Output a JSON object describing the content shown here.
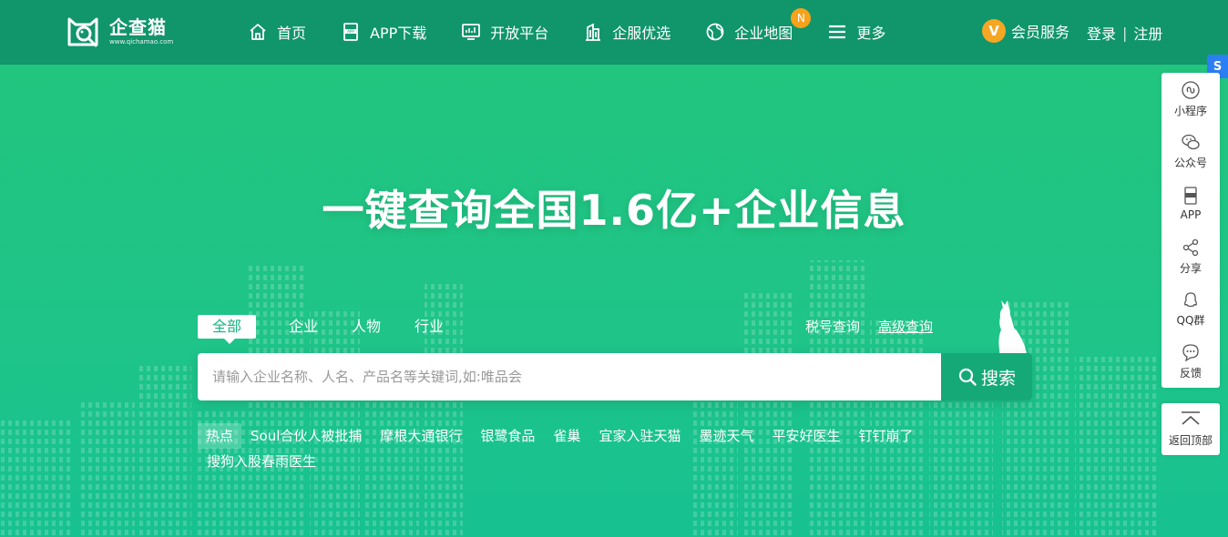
{
  "brand": {
    "name": "企查猫",
    "url": "www.qichamao.com"
  },
  "nav": {
    "items": [
      {
        "label": "首页",
        "icon": "home-icon"
      },
      {
        "label": "APP下载",
        "icon": "app-download-icon"
      },
      {
        "label": "开放平台",
        "icon": "monitor-icon"
      },
      {
        "label": "企服优选",
        "icon": "building-icon"
      },
      {
        "label": "企业地图",
        "icon": "globe-icon",
        "badge": "N"
      },
      {
        "label": "更多",
        "icon": "menu-icon"
      }
    ],
    "vip_icon_letter": "V",
    "vip_label": "会员服务",
    "login": "登录",
    "separator": "|",
    "register": "注册"
  },
  "hero": {
    "headline": "一键查询全国1.6亿+企业信息"
  },
  "search": {
    "tabs": [
      "全部",
      "企业",
      "人物",
      "行业"
    ],
    "active_tab": "全部",
    "links": [
      "税号查询",
      "高级查询"
    ],
    "placeholder": "请输入企业名称、人名、产品名等关键词,如:唯品会",
    "value": "",
    "button_label": "搜索"
  },
  "hot": {
    "label": "热点",
    "items": [
      "Soul合伙人被批捕",
      "摩根大通银行",
      "银鹭食品",
      "雀巢",
      "宜家入驻天猫",
      "墨迹天气",
      "平安好医生",
      "钉钉崩了",
      "搜狗入股春雨医生"
    ]
  },
  "sidebar": {
    "items": [
      {
        "label": "小程序",
        "icon": "mini-program-icon"
      },
      {
        "label": "公众号",
        "icon": "wechat-icon"
      },
      {
        "label": "APP",
        "icon": "app-icon"
      },
      {
        "label": "分享",
        "icon": "share-icon"
      },
      {
        "label": "QQ群",
        "icon": "qq-icon"
      },
      {
        "label": "反馈",
        "icon": "feedback-icon"
      }
    ],
    "back_to_top": "返回顶部"
  },
  "colors": {
    "nav_bg": "#11956b",
    "hero_bg": "#1fc48a",
    "search_button": "#16a978",
    "badge": "#f7a21b",
    "vip": "#f5a623",
    "side_tab": "#2b7ff2"
  }
}
